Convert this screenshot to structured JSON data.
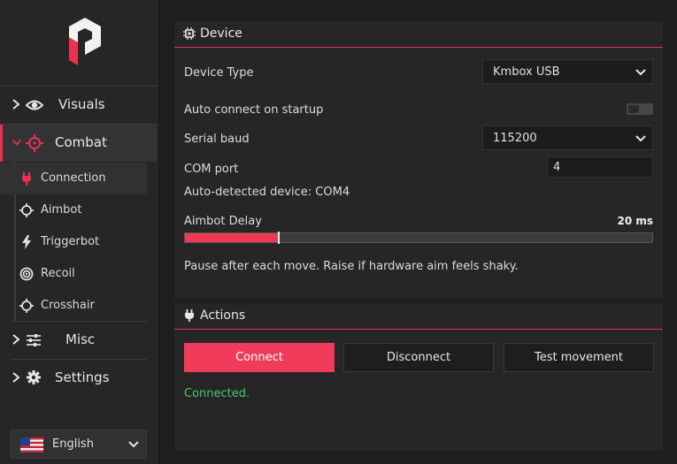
{
  "colors": {
    "accent": "#e8324f",
    "success": "#48c964",
    "panel": "#262627",
    "background": "#1e1e1f"
  },
  "sidebar": {
    "logo_icon": "brand-logo",
    "nav": [
      {
        "label": "Visuals",
        "icon": "eye-icon",
        "chevron": "chevron-right-icon",
        "active": false
      },
      {
        "label": "Combat",
        "icon": "crosshair-target-icon",
        "chevron": "chevron-down-icon",
        "active": true
      },
      {
        "label": "Misc",
        "icon": "sliders-icon",
        "chevron": "chevron-right-icon",
        "active": false
      },
      {
        "label": "Settings",
        "icon": "gear-icon",
        "chevron": "chevron-right-icon",
        "active": false
      }
    ],
    "subitems": [
      {
        "label": "Connection",
        "icon": "plug-icon",
        "active": true
      },
      {
        "label": "Aimbot",
        "icon": "crosshair-icon",
        "active": false
      },
      {
        "label": "Triggerbot",
        "icon": "lightning-icon",
        "active": false
      },
      {
        "label": "Recoil",
        "icon": "target-icon",
        "active": false
      },
      {
        "label": "Crosshair",
        "icon": "crosshair-icon",
        "active": false
      }
    ],
    "language": {
      "label": "English",
      "flag": "us-flag-icon"
    }
  },
  "device": {
    "title": "Device",
    "icon": "chip-icon",
    "device_type_label": "Device Type",
    "device_type_value": "Kmbox USB",
    "auto_connect_label": "Auto connect on startup",
    "auto_connect_enabled": false,
    "serial_baud_label": "Serial baud",
    "serial_baud_value": "115200",
    "com_port_label": "COM port",
    "com_port_value": "4",
    "auto_detected": "Auto-detected device: COM4",
    "aimbot_delay_label": "Aimbot Delay",
    "aimbot_delay_value": "20 ms",
    "aimbot_delay_fraction": 0.2,
    "hint": "Pause after each move. Raise if hardware aim feels shaky."
  },
  "actions": {
    "title": "Actions",
    "icon": "plug-icon",
    "connect_label": "Connect",
    "disconnect_label": "Disconnect",
    "test_label": "Test movement",
    "status": "Connected."
  }
}
